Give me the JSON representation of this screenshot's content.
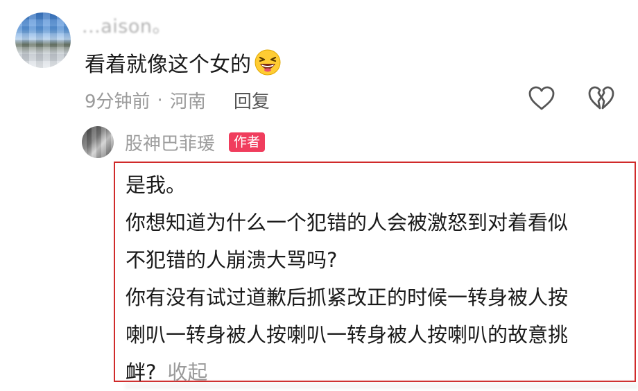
{
  "top_comment": {
    "username": "...aison。",
    "text": "看着就像这个女的",
    "emoji": "laughing-emoji",
    "time": "9分钟前",
    "separator": "·",
    "location": "河南",
    "reply_label": "回复",
    "like_icon": "heart-outline-icon",
    "dislike_icon": "broken-heart-outline-icon"
  },
  "author_reply": {
    "username": "股神巴菲瑗",
    "badge": "作者",
    "badge_color": "#f03d5d",
    "lines": [
      "是我。",
      "你想知道为什么一个犯错的人会被激怒到对着看似",
      "不犯错的人崩溃大骂吗?",
      "你有没有试过道歉后抓紧改正的时候一转身被人按",
      "喇叭一转身被人按喇叭一转身被人按喇叭的故意挑",
      "衅?"
    ],
    "collapse_label": "收起"
  },
  "colors": {
    "highlight_border": "#d02a2a",
    "secondary_text": "#9a9a9a"
  }
}
